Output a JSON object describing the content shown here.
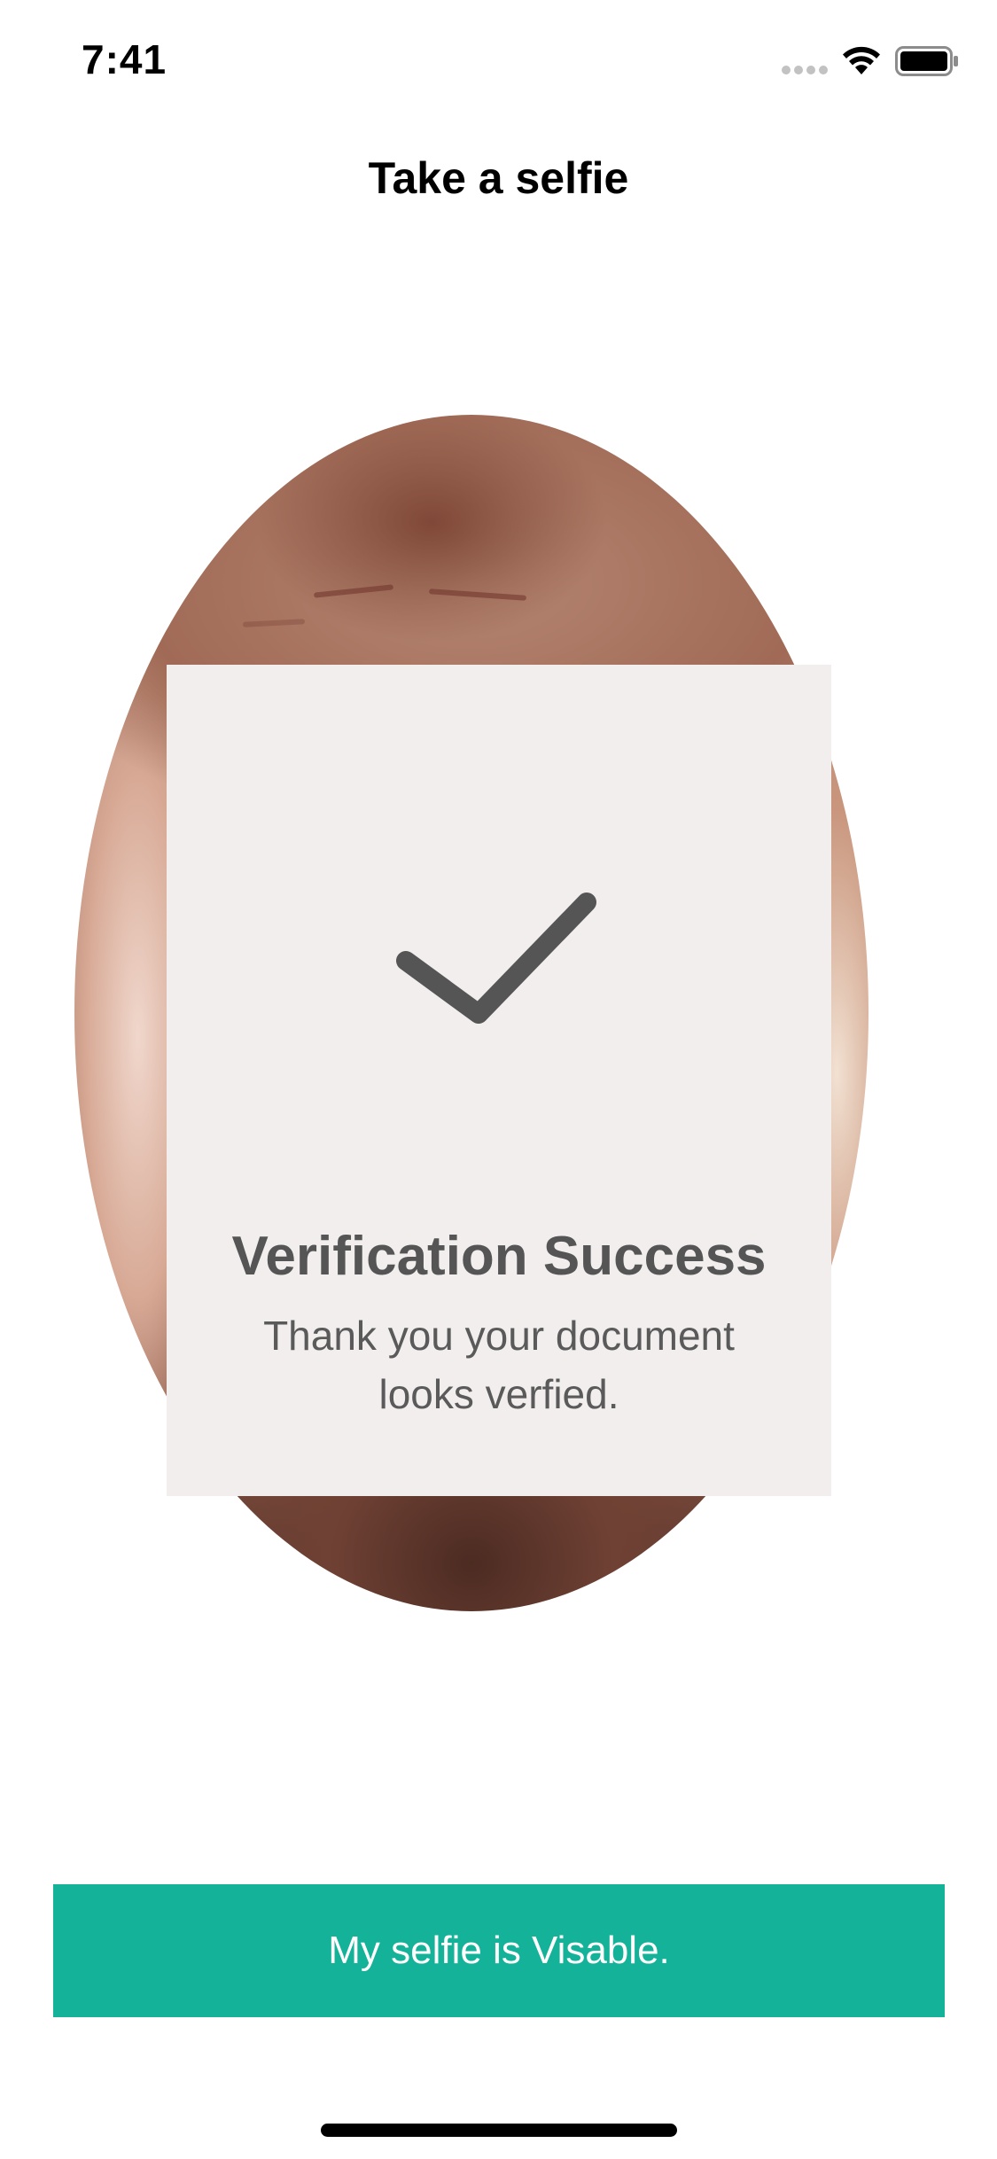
{
  "status_bar": {
    "time": "7:41",
    "icons": [
      "signal-icon",
      "wifi-icon",
      "battery-icon"
    ]
  },
  "header": {
    "title": "Take a selfie"
  },
  "selfie": {
    "shape": "oval",
    "content": "user-face-camera-preview"
  },
  "verification": {
    "icon": "checkmark-icon",
    "title": "Verification Success",
    "message": "Thank you your document looks verfied."
  },
  "footer": {
    "button_label": "My selfie is Visable."
  },
  "colors": {
    "accent": "#14b298",
    "card_background": "#f2eeed",
    "text_dark": "#555555"
  }
}
